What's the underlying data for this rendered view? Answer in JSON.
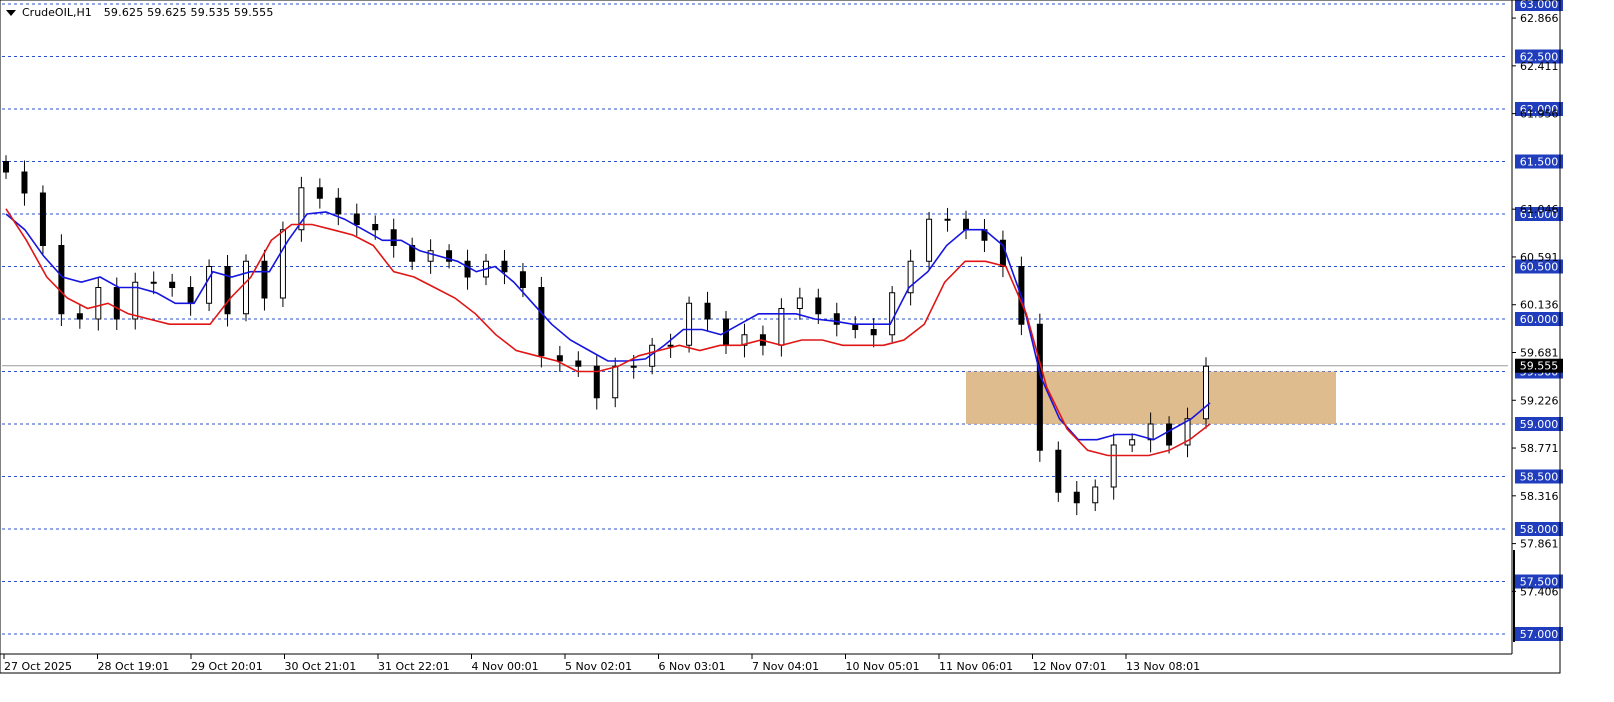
{
  "header": {
    "symbol": "CrudeOIL,H1",
    "ohlc": "59.625 59.625 59.535 59.555"
  },
  "colors": {
    "background": "#ffffff",
    "grid": "#2b4fc9",
    "candle": "#000000",
    "ema_fast": "#1515e0",
    "ema_slow": "#e01515",
    "zone": "#d9b07a",
    "label_bg": "#1f3dbd",
    "label_text": "#ffffff",
    "current_price_bg": "#000000"
  },
  "chart_data": {
    "type": "line",
    "title": "CrudeOIL,H1",
    "x_labels": [
      "27 Oct 2025",
      "28 Oct 19:01",
      "29 Oct 20:01",
      "30 Oct 21:01",
      "31 Oct 22:01",
      "4 Nov 00:01",
      "5 Nov 02:01",
      "6 Nov 03:01",
      "7 Nov 04:01",
      "10 Nov 05:01",
      "11 Nov 06:01",
      "12 Nov 07:01",
      "13 Nov 08:01"
    ],
    "ylim": [
      57.0,
      63.0
    ],
    "y_levels_labeled": [
      "63.000",
      "62.500",
      "62.000",
      "61.500",
      "61.000",
      "60.500",
      "60.000",
      "59.500",
      "59.000",
      "58.500",
      "58.000",
      "57.500",
      "57.000"
    ],
    "y_ticks_plain": [
      "62.866",
      "62.411",
      "61.956",
      "61.046",
      "60.591",
      "60.136",
      "59.681",
      "59.226",
      "58.771",
      "58.316",
      "57.861",
      "57.406"
    ],
    "current_price": "59.555",
    "price_close": [
      61.4,
      61.2,
      60.7,
      60.05,
      60.0,
      60.3,
      60.0,
      60.35,
      60.35,
      60.3,
      60.15,
      60.5,
      60.05,
      60.55,
      60.2,
      60.85,
      61.25,
      61.15,
      61.0,
      60.9,
      60.85,
      60.7,
      60.55,
      60.65,
      60.55,
      60.4,
      60.55,
      60.45,
      60.3,
      59.65,
      59.6,
      59.55,
      59.25,
      59.55,
      59.55,
      59.75,
      59.75,
      60.15,
      60.0,
      59.75,
      59.85,
      59.75,
      60.1,
      60.2,
      60.05,
      59.95,
      59.9,
      59.85,
      60.25,
      60.55,
      60.95,
      60.95,
      60.85,
      60.75,
      60.5,
      59.95,
      58.75,
      58.35,
      58.25,
      58.4,
      58.8,
      58.85,
      59.0,
      58.8,
      59.05,
      59.55
    ],
    "ema_fast": [
      61.0,
      60.85,
      60.6,
      60.4,
      60.35,
      60.4,
      60.3,
      60.3,
      60.25,
      60.15,
      60.15,
      60.45,
      60.4,
      60.45,
      60.45,
      60.75,
      61.0,
      61.02,
      60.95,
      60.85,
      60.75,
      60.75,
      60.65,
      60.6,
      60.55,
      60.45,
      60.5,
      60.35,
      60.15,
      59.95,
      59.8,
      59.7,
      59.6,
      59.6,
      59.62,
      59.75,
      59.9,
      59.9,
      59.85,
      59.95,
      60.05,
      60.05,
      60.05,
      60.0,
      59.98,
      59.95,
      59.95,
      59.95,
      60.3,
      60.45,
      60.7,
      60.85,
      60.85,
      60.7,
      60.2,
      59.45,
      59.05,
      58.85,
      58.85,
      58.9,
      58.9,
      58.85,
      58.95,
      59.05,
      59.2
    ],
    "ema_slow": [
      61.05,
      60.75,
      60.4,
      60.2,
      60.1,
      60.15,
      60.05,
      60.0,
      59.95,
      59.95,
      59.95,
      60.2,
      60.4,
      60.75,
      60.9,
      60.9,
      60.85,
      60.8,
      60.7,
      60.45,
      60.4,
      60.3,
      60.2,
      60.05,
      59.85,
      59.7,
      59.65,
      59.6,
      59.5,
      59.5,
      59.55,
      59.65,
      59.7,
      59.75,
      59.7,
      59.75,
      59.75,
      59.8,
      59.75,
      59.8,
      59.8,
      59.75,
      59.75,
      59.75,
      59.8,
      59.95,
      60.35,
      60.55,
      60.55,
      60.5,
      60.05,
      59.35,
      58.95,
      58.75,
      58.7,
      58.7,
      58.7,
      58.75,
      58.85,
      59.0
    ]
  }
}
